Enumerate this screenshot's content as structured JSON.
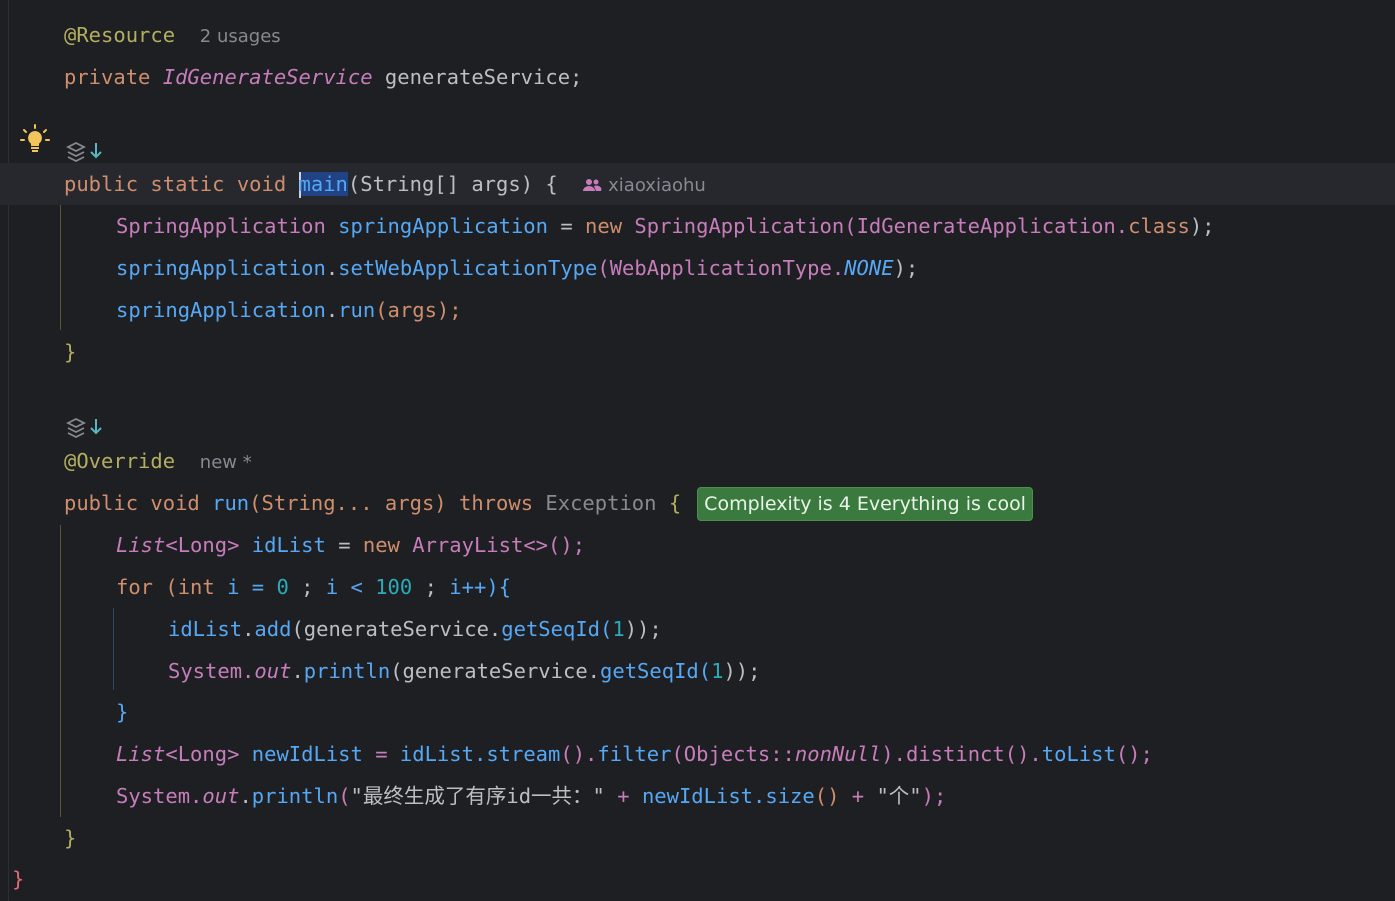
{
  "editor": {
    "lines": {
      "l1_annotation": "@Resource",
      "l1_hint": "2 usages",
      "l2_private": "private",
      "l2_type": "IdGenerateService",
      "l2_name": "generateService;",
      "l4_public": "public",
      "l4_static": "static",
      "l4_void": "void",
      "l4_main": "main",
      "l4_paren": "(String[] args) {",
      "l4_author": "xiaoxiaohu",
      "l5_type": "SpringApplication",
      "l5_var": "springApplication",
      "l5_eq": "=",
      "l5_new": "new",
      "l5_ctor": "SpringApplication",
      "l5_arg": "(IdGenerateApplication.",
      "l5_class": "class",
      "l5_end": ");",
      "l6_var": "springApplication",
      "l6_dot": ".",
      "l6_fn": "setWebApplicationType",
      "l6_arg": "(WebApplicationType.",
      "l6_none": "NONE",
      "l6_end": ");",
      "l7_var": "springApplication",
      "l7_dot": ".",
      "l7_fn": "run",
      "l7_arg": "(args);",
      "l8_close": "}",
      "l10_annotation": "@Override",
      "l10_hint": "new *",
      "l11_public": "public",
      "l11_void": "void",
      "l11_fn": "run",
      "l11_params": "(String... args)",
      "l11_throws": "throws",
      "l11_exc": "Exception",
      "l11_brace": "{",
      "l11_badge": "Complexity is 4 Everything is cool",
      "l12_list": "List",
      "l12_generic": "<Long>",
      "l12_var": "idList",
      "l12_eq": "=",
      "l12_new": "new",
      "l12_ctor": "ArrayList",
      "l12_end": "<>();",
      "l13_for": "for",
      "l13_open": "(",
      "l13_int": "int",
      "l13_i": "i",
      "l13_eq": "=",
      "l13_zero": "0",
      "l13_semi1": ";",
      "l13_i2": "i",
      "l13_lt": "<",
      "l13_hundred": "100",
      "l13_semi2": ";",
      "l13_inc": "i++",
      "l13_close": "){",
      "l14_var": "idList",
      "l14_dot": ".",
      "l14_fn": "add",
      "l14_arg": "(generateService.",
      "l14_fn2": "getSeqId",
      "l14_num": "1",
      "l14_end": "));",
      "l15_sys": "System.",
      "l15_out": "out",
      "l15_dot": ".",
      "l15_fn": "println",
      "l15_arg": "(generateService.",
      "l15_fn2": "getSeqId",
      "l15_num": "1",
      "l15_end": "));",
      "l16_close": "}",
      "l17_list": "List",
      "l17_generic": "<Long>",
      "l17_var": "newIdList",
      "l17_eq": "=",
      "l17_src": "idList.",
      "l17_fn1": "stream",
      "l17_fn2": "filter",
      "l17_obj": "(Objects::",
      "l17_nonnull": "nonNull",
      "l17_fn3": "distinct",
      "l17_fn4": "toList",
      "l18_sys": "System.",
      "l18_out": "out",
      "l18_fn": "println",
      "l18_str1": "\"最终生成了有序id一共：\"",
      "l18_plus": "+",
      "l18_var": "newIdList.",
      "l18_fn2": "size",
      "l18_plus2": "+",
      "l18_str2": "\"个\"",
      "l18_end": ");",
      "l19_close": "}",
      "l20_close": "}"
    }
  },
  "icons": {
    "intention": "lightbulb-icon",
    "implements": "implements-gutter-icon",
    "author": "people-icon"
  }
}
